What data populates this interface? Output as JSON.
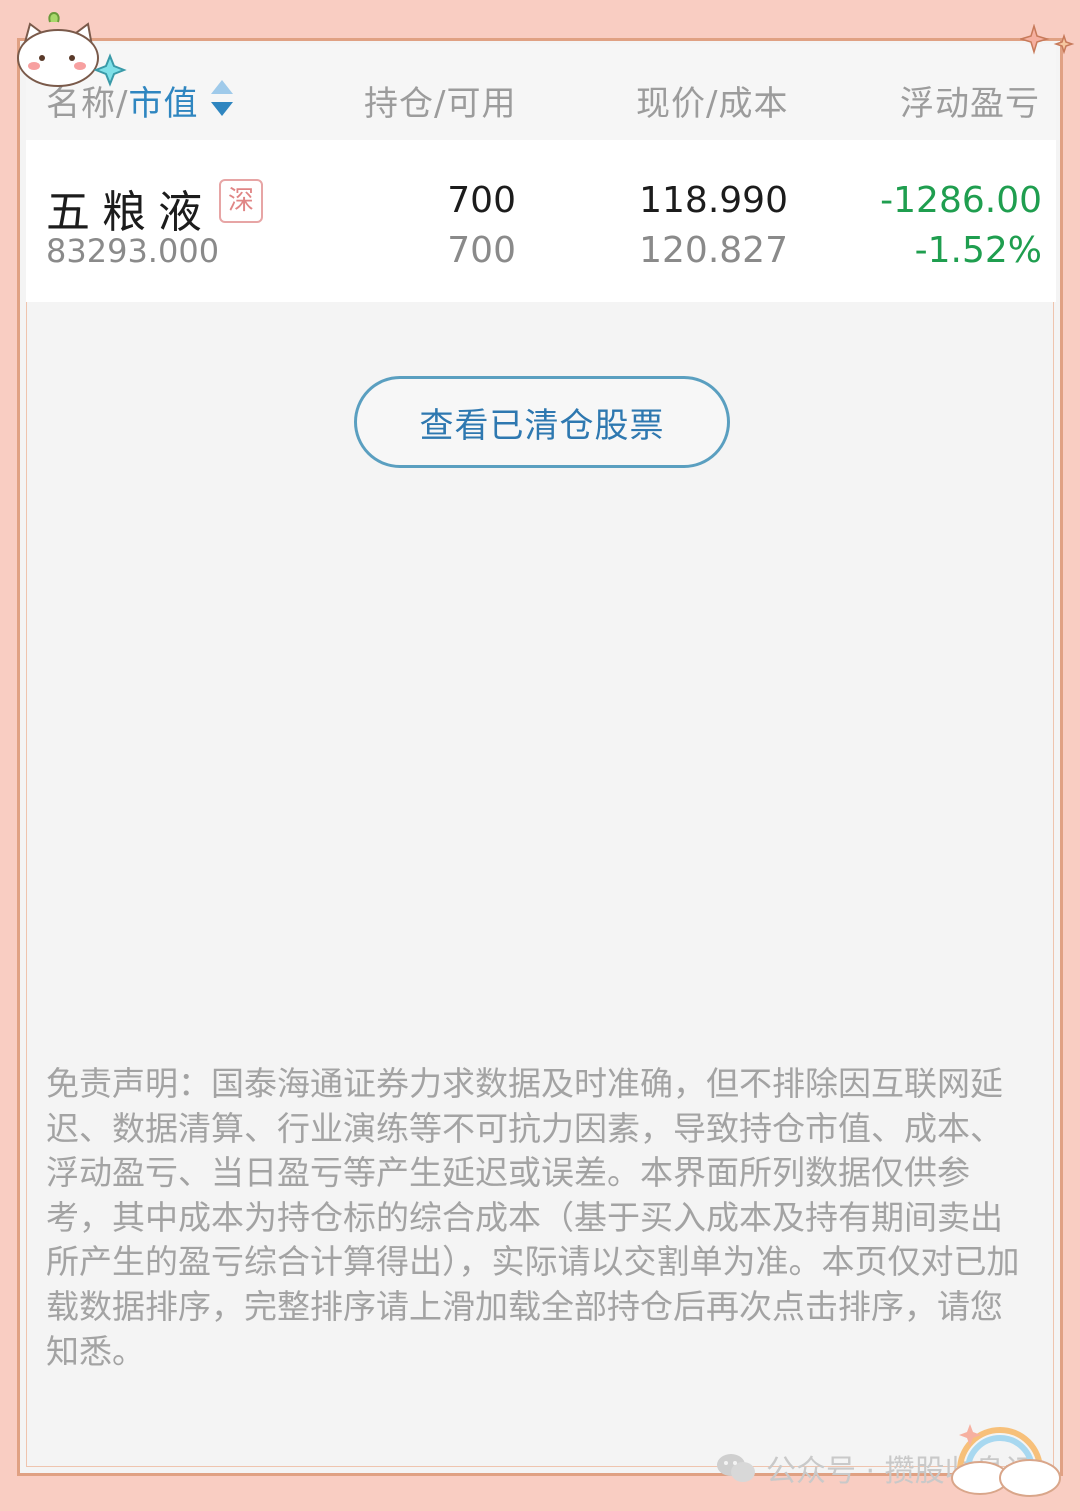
{
  "header": {
    "name_label": "名称/",
    "market_value_label": "市值",
    "position_label": "持仓/可用",
    "price_label": "现价/成本",
    "pnl_label": "浮动盈亏"
  },
  "holding": {
    "name": "五粮液",
    "exchange_tag": "深",
    "market_value": "83293.000",
    "position": "700",
    "available": "700",
    "current_price": "118.990",
    "cost": "120.827",
    "pnl_amount": "-1286.00",
    "pnl_percent": "-1.52%"
  },
  "cleared_button_label": "查看已清仓股票",
  "disclaimer": "免责声明：国泰海通证券力求数据及时准确，但不排除因互联网延迟、数据清算、行业演练等不可抗力因素，导致持仓市值、成本、浮动盈亏、当日盈亏等产生延迟或误差。本界面所列数据仅供参考，其中成本为持仓标的综合成本（基于买入成本及持有期间卖出所产生的盈亏综合计算得出），实际请以交割单为准。本页仅对已加载数据排序，完整排序请上滑加载全部持仓后再次点击排序，请您知悉。",
  "watermark": "公众号 · 攒股收息记",
  "colors": {
    "accent": "#2f86c0",
    "loss_green": "#1f9e4f",
    "frame_pink": "#f9cdc2"
  }
}
